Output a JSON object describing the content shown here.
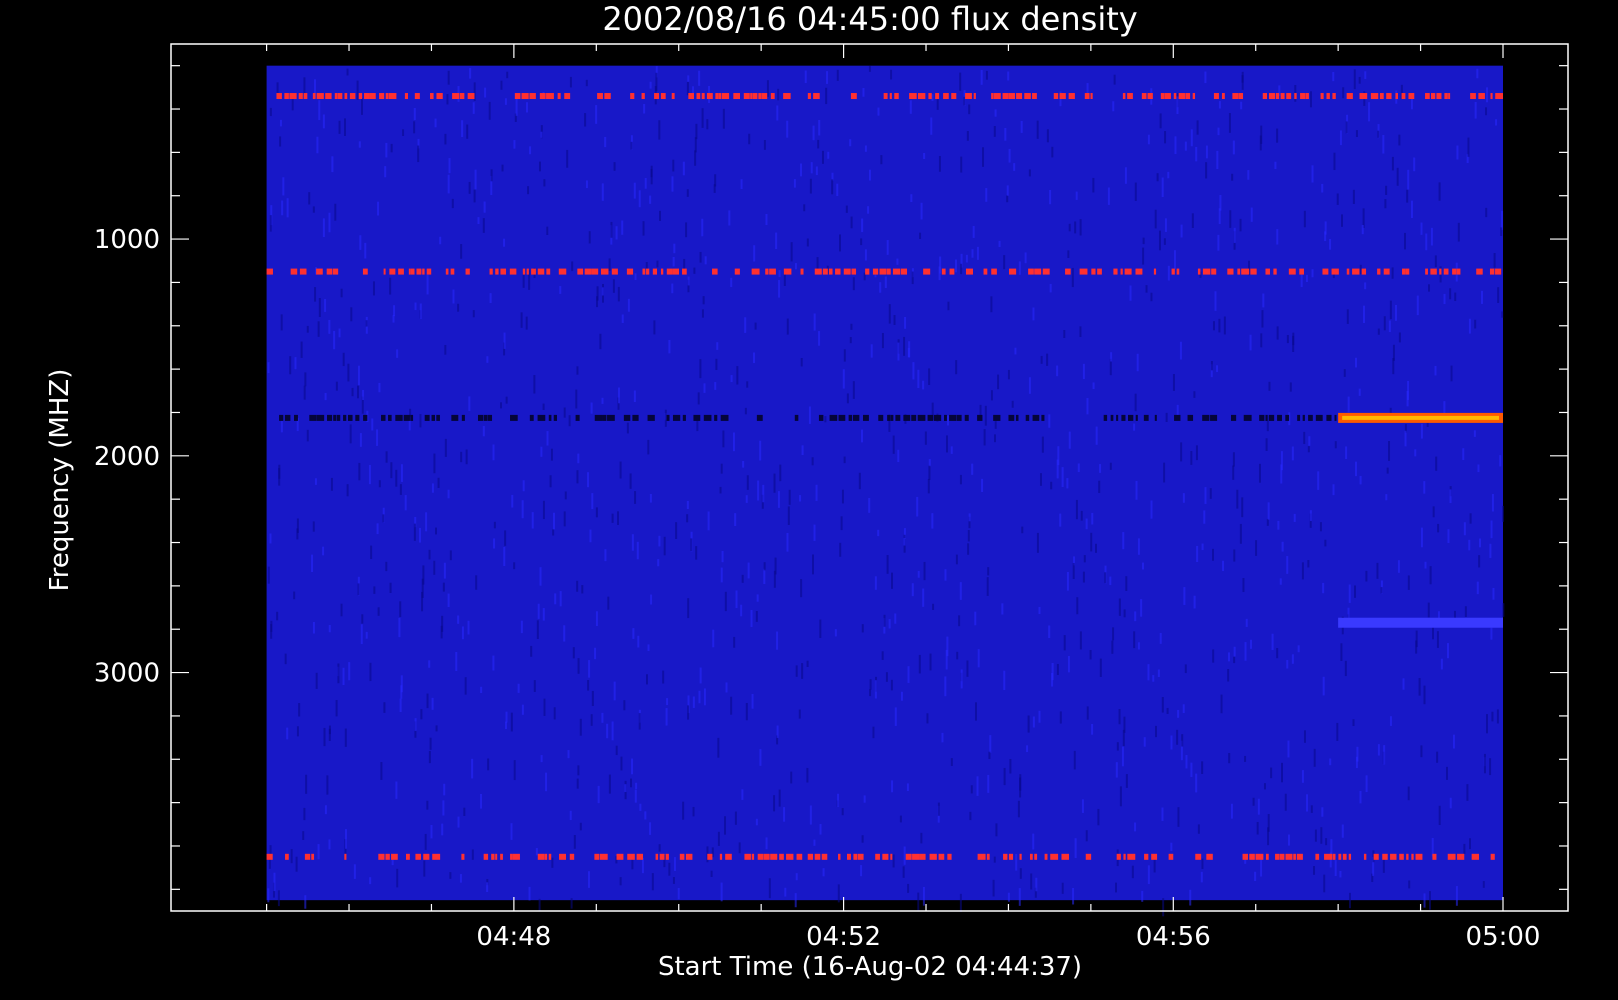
{
  "chart_data": {
    "type": "heatmap",
    "title": "2002/08/16 04:45:00 flux density",
    "xlabel": "Start Time (16-Aug-02 04:44:37)",
    "ylabel": "Frequency (MHZ)",
    "x_start": "04:44:37",
    "x_end": "05:00:00",
    "x_ticks": [
      "04:48",
      "04:52",
      "04:56",
      "05:00"
    ],
    "x_tick_minutes": [
      48,
      52,
      56,
      60
    ],
    "y_ticks": [
      "1000",
      "2000",
      "3000"
    ],
    "y_tick_values": [
      1000,
      2000,
      3000
    ],
    "ylim": [
      4100,
      100
    ],
    "data_extent": {
      "freq_min_mhz": 200,
      "freq_max_mhz": 4050,
      "time_start_min": 45.0,
      "time_end_min": 60.0
    },
    "colormap": [
      "#000000",
      "#0000ff",
      "#ff0000",
      "#ffff00"
    ],
    "background_level": "blue",
    "features": [
      {
        "freq_mhz": 340,
        "time_from_min": 45.0,
        "time_to_min": 60.0,
        "level": "bright",
        "type": "dashed-band"
      },
      {
        "freq_mhz": 1150,
        "time_from_min": 45.0,
        "time_to_min": 60.0,
        "level": "bright",
        "type": "dashed-band"
      },
      {
        "freq_mhz": 1825,
        "time_from_min": 45.0,
        "time_to_min": 58.0,
        "level": "dark",
        "type": "dashed-band"
      },
      {
        "freq_mhz": 1825,
        "time_from_min": 58.0,
        "time_to_min": 60.0,
        "level": "very-bright",
        "type": "solid-band"
      },
      {
        "freq_mhz": 3850,
        "time_from_min": 45.0,
        "time_to_min": 60.0,
        "level": "bright",
        "type": "dashed-band"
      },
      {
        "freq_mhz": 2770,
        "time_from_min": 58.0,
        "time_to_min": 60.0,
        "level": "light",
        "type": "solid-band"
      }
    ]
  }
}
